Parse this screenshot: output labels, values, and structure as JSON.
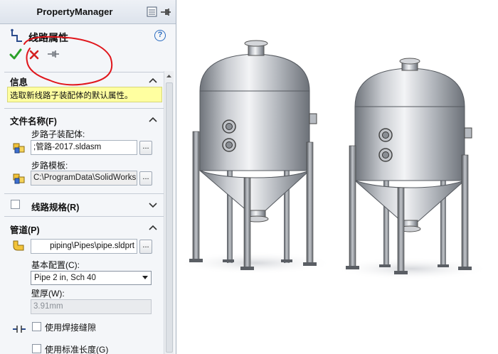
{
  "panel": {
    "title": "PropertyManager",
    "feature_title": "线路属性",
    "actions": {
      "ok_icon": "check-icon",
      "cancel_icon": "close-icon",
      "pin_icon": "pushpin-icon"
    }
  },
  "info_section": {
    "title": "信息",
    "message": "选取新线路子装配体的默认属性。"
  },
  "file_section": {
    "title": "文件名称(F)",
    "assembly_label": "步路子装配体:",
    "assembly_value": ";管路-2017.sldasm",
    "template_label": "步路模板:",
    "template_value": "C:\\ProgramData\\SolidWorks",
    "browse_label": "..."
  },
  "route_spec_section": {
    "title": "线路规格(R)"
  },
  "pipe_section": {
    "title": "管道(P)",
    "pipe_file_value": "piping\\Pipes\\pipe.sldprt",
    "browse_label": "...",
    "config_label": "基本配置(C):",
    "config_value": "Pipe 2 in, Sch 40",
    "wall_label": "壁厚(W):",
    "wall_value": "3.91mm",
    "weld_gap_label": "使用焊接缝隙",
    "std_length_label": "使用标准长度(G)"
  },
  "colors": {
    "annotation_red": "#e0161c",
    "ok_green": "#2aa12a",
    "cancel_red": "#d42020",
    "info_yellow": "#ffffa0"
  }
}
